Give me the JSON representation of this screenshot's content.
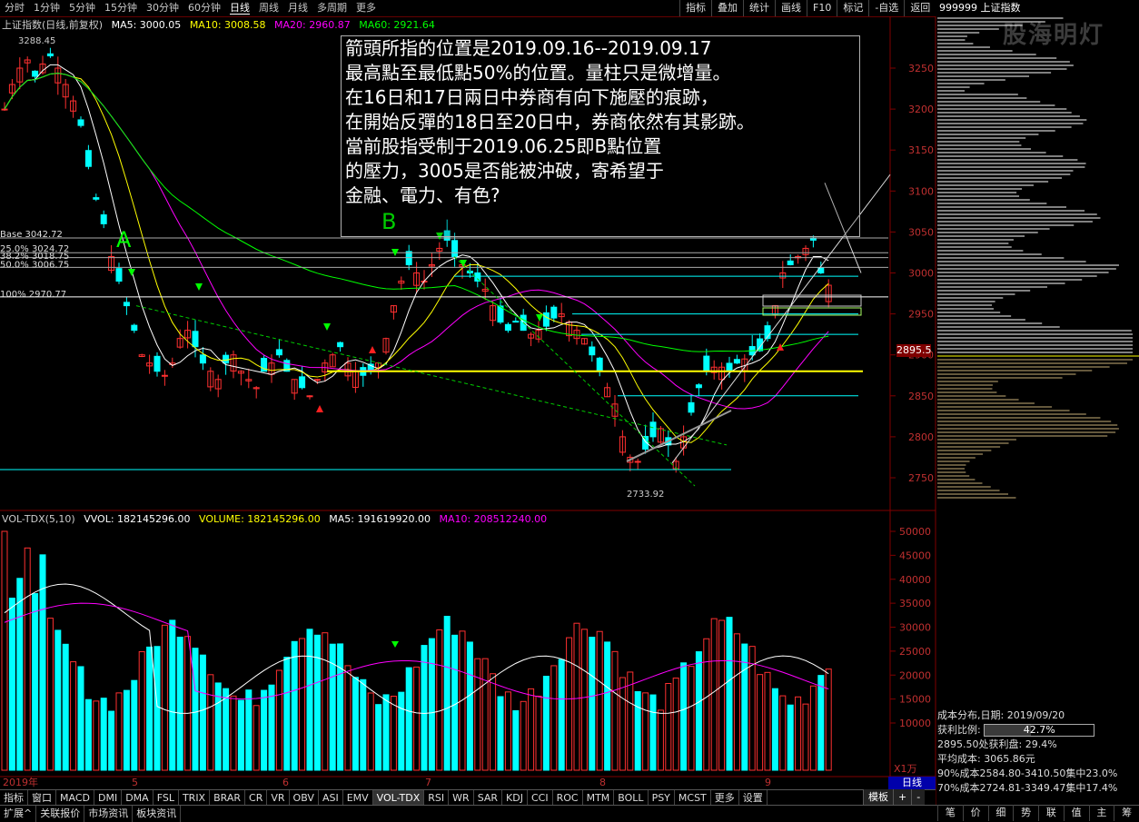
{
  "topbar": {
    "periods": [
      "分时",
      "1分钟",
      "5分钟",
      "15分钟",
      "30分钟",
      "60分钟",
      "日线",
      "周线",
      "月线",
      "多周期",
      "更多"
    ],
    "selected": "日线",
    "buttons": [
      "指标",
      "叠加",
      "统计",
      "画线",
      "F10",
      "标记",
      "-自选",
      "返回"
    ],
    "code": "999999 上证指数"
  },
  "watermark": "股海明灯",
  "price_legend": {
    "title": "上证指数(日线,前复权)",
    "ma5": "MA5: 3000.05",
    "ma10": "MA10: 3008.58",
    "ma20": "MA20: 2960.87",
    "ma60": "MA60: 2921.64"
  },
  "vol_legend": {
    "name": "VOL-TDX(5,10)",
    "vvol": "VVOL: 182145296.00",
    "volume": "VOLUME: 182145296.00",
    "ma5": "MA5: 191619920.00",
    "ma10": "MA10: 208512240.00"
  },
  "price_axis": [
    "3250",
    "3200",
    "3150",
    "3100",
    "3050",
    "3000",
    "2950",
    "2900",
    "2850",
    "2800",
    "2750"
  ],
  "vol_axis": [
    "50000",
    "45000",
    "40000",
    "35000",
    "30000",
    "25000",
    "20000",
    "15000",
    "10000"
  ],
  "vol_unit": "X1万",
  "current_price": "2895.5",
  "high_label": "3288.45",
  "low_label": "2733.92",
  "fib": {
    "base": "Base 3042.72",
    "f25": "25.0% 3024.72",
    "f38": "38.2% 3018.75",
    "f50": "50.0% 3006.75",
    "f100": "100% 2970.77"
  },
  "point_labels": {
    "a": "A",
    "b": "B"
  },
  "annotation": [
    "箭頭所指的位置是2019.09.16--2019.09.17",
    "最高點至最低點50%的位置。量柱只是微增量。",
    "在16日和17日兩日中券商有向下施壓的痕跡，",
    "在開始反彈的18日至20日中，券商依然有其影跡。",
    "當前股指受制于2019.06.25即B點位置",
    "的壓力，3005是否能被沖破，寄希望于",
    "金融、電力、有色?"
  ],
  "dates": {
    "year": "2019年",
    "m5": "5",
    "m6": "6",
    "m7": "7",
    "m8": "8",
    "m9": "9"
  },
  "right_day": "日线",
  "cost_dist": {
    "title": "成本分布,日期:",
    "date": "2019/09/20",
    "profit_label": "获利比例:",
    "profit_value": "42.7%",
    "profit_ratio": 0.427,
    "at_price": "2895.50处获利盘:",
    "at_price_value": "29.4%",
    "avg_label": "平均成本:",
    "avg_value": "3065.86元",
    "c90": "90%成本2584.80-3410.50集中23.0%",
    "c70": "70%成本2724.81-3349.47集中17.4%"
  },
  "indicator_tabs": [
    "指标",
    "窗口",
    "MACD",
    "DMI",
    "DMA",
    "FSL",
    "TRIX",
    "BRAR",
    "CR",
    "VR",
    "OBV",
    "ASI",
    "EMV",
    "VOL-TDX",
    "RSI",
    "WR",
    "SAR",
    "KDJ",
    "CCI",
    "ROC",
    "MTM",
    "BOLL",
    "PSY",
    "MCST",
    "更多",
    "设置"
  ],
  "indicator_selected": "VOL-TDX",
  "side_buttons": [
    "模板",
    "+",
    "-"
  ],
  "bottom_tabs": [
    "扩展^",
    "关联报价",
    "市场资讯",
    "板块资讯"
  ],
  "right_tabs": [
    "笔",
    "价",
    "细",
    "势",
    "联",
    "值",
    "主",
    "筹"
  ],
  "colors": {
    "up": "#ff3030",
    "down": "#00ffff",
    "ma5": "#ffffff",
    "ma10": "#ffff00",
    "ma20": "#ff00ff",
    "ma60": "#00ff00",
    "grid": "#7f0000"
  }
}
